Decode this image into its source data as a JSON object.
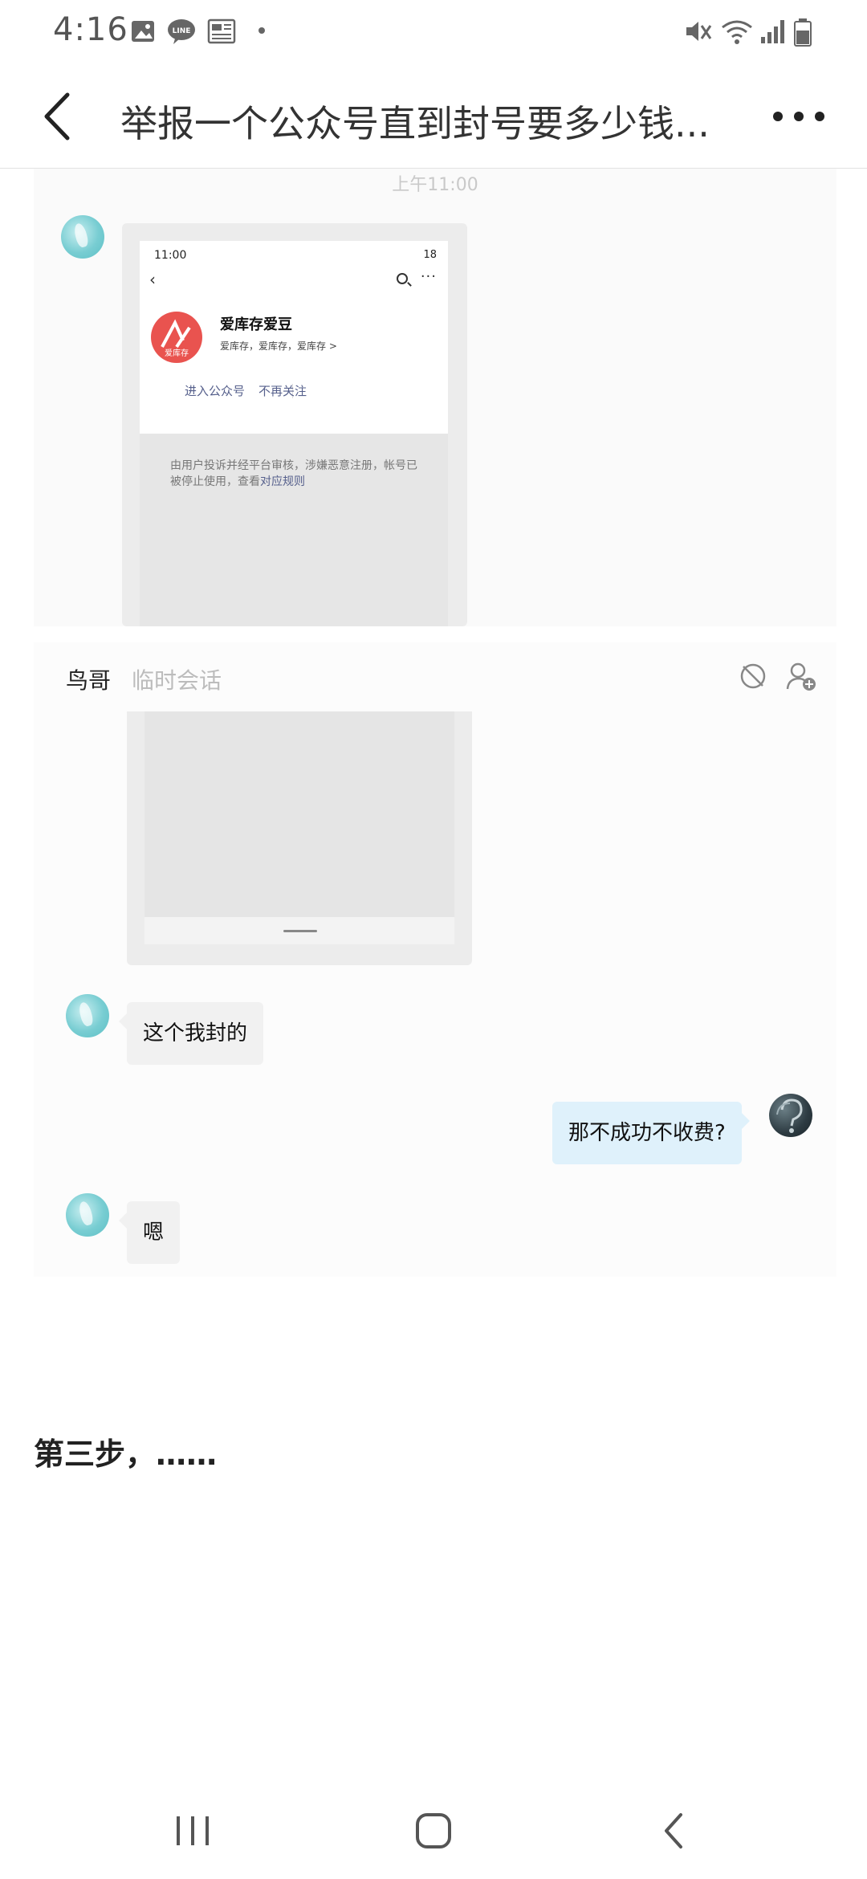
{
  "status_bar": {
    "time": "4:16",
    "icons": [
      "gallery-icon",
      "line-app-icon",
      "news-icon",
      "mute-icon",
      "wifi-icon",
      "signal-icon",
      "battery-icon"
    ]
  },
  "header": {
    "title": "举报一个公众号直到封号要多少钱..."
  },
  "screenshot_1": {
    "time_label": "上午11:00",
    "inner_phone": {
      "time": "11:00",
      "status_right": "18",
      "account_name": "爱库存爱豆",
      "account_sub": "爱库存，爱库存，爱库存 >",
      "logo_text": "爱库存",
      "button_enter": "进入公众号",
      "button_unfollow": "不再关注",
      "notice_text": "由用户投诉并经平台审核，涉嫌恶意注册，帐号已被停止使用，查看",
      "notice_link": "对应规则"
    }
  },
  "screenshot_2": {
    "contact_name": "鸟哥",
    "session_type": "临时会话",
    "messages": [
      {
        "from": "other",
        "text": "这个我封的"
      },
      {
        "from": "me",
        "text": "那不成功不收费?"
      },
      {
        "from": "other",
        "text": "嗯"
      }
    ]
  },
  "article": {
    "step_text": "第三步，……"
  },
  "colors": {
    "accent_link": "#56608c",
    "my_bubble": "#dff1fb",
    "other_bubble": "#f1f1f1",
    "logo_red": "#e9534f"
  }
}
